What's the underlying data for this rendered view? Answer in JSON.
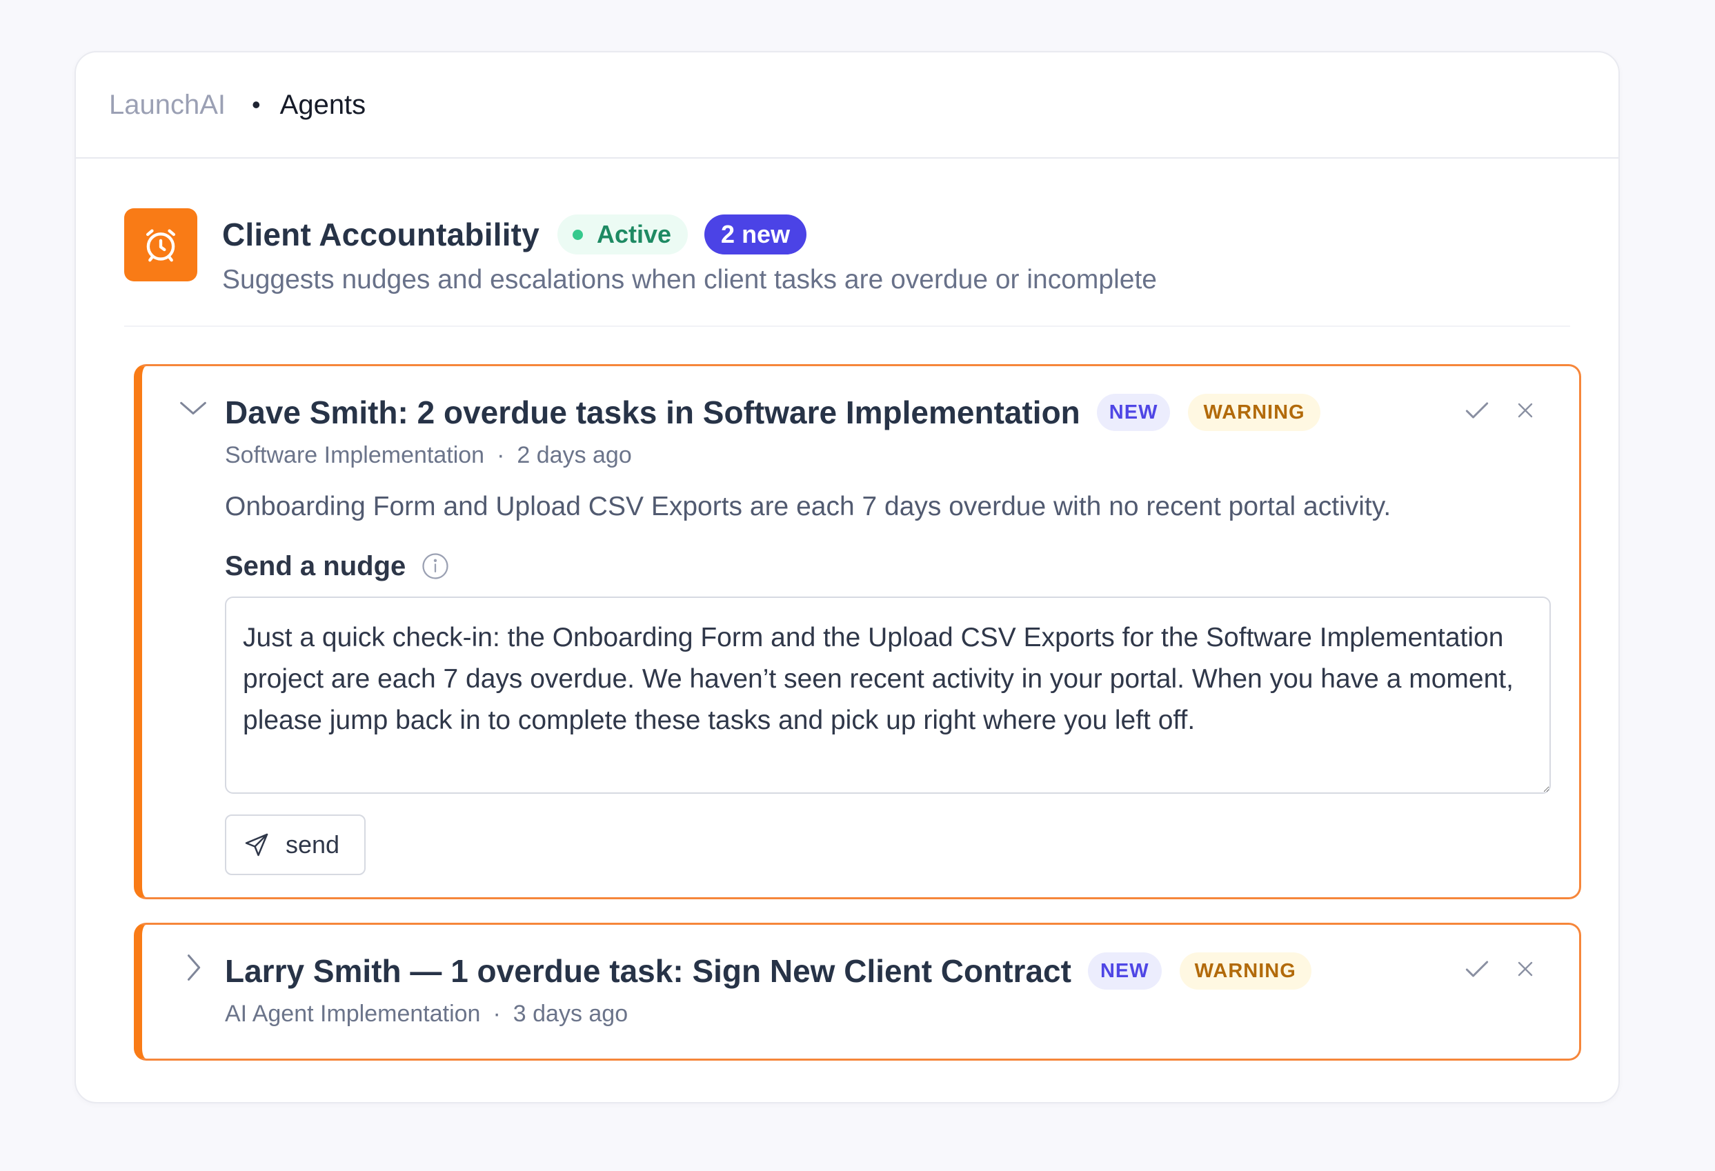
{
  "breadcrumb": {
    "root": "LaunchAI",
    "separator": "•",
    "current": "Agents"
  },
  "agent": {
    "icon": "alarm-clock-icon",
    "title": "Client Accountability",
    "status": "Active",
    "new_count": "2 new",
    "description": "Suggests nudges and escalations when client tasks are overdue or incomplete"
  },
  "cards": [
    {
      "expanded": true,
      "title": "Dave Smith: 2 overdue tasks in Software Implementation",
      "tag_new": "NEW",
      "tag_warning": "WARNING",
      "project": "Software Implementation",
      "separator": "·",
      "time": "2 days ago",
      "summary": "Onboarding Form and Upload CSV Exports are each 7 days overdue with no recent portal activity.",
      "nudge_label": "Send a nudge",
      "nudge_text": "Just a quick check-in: the Onboarding Form and the Upload CSV Exports for the Software Implementation project are each 7 days overdue. We haven’t seen recent activity in your portal. When you have a moment, please jump back in to complete these tasks and pick up right where you left off.",
      "send_label": "send"
    },
    {
      "expanded": false,
      "title": "Larry Smith — 1 overdue task: Sign New Client Contract",
      "tag_new": "NEW",
      "tag_warning": "WARNING",
      "project": "AI Agent Implementation",
      "separator": "·",
      "time": "3 days ago"
    }
  ],
  "colors": {
    "accent_orange": "#f97b16",
    "active_green": "#1e8a63",
    "new_indigo": "#4b43e6",
    "warning_amber": "#b26a0a"
  }
}
